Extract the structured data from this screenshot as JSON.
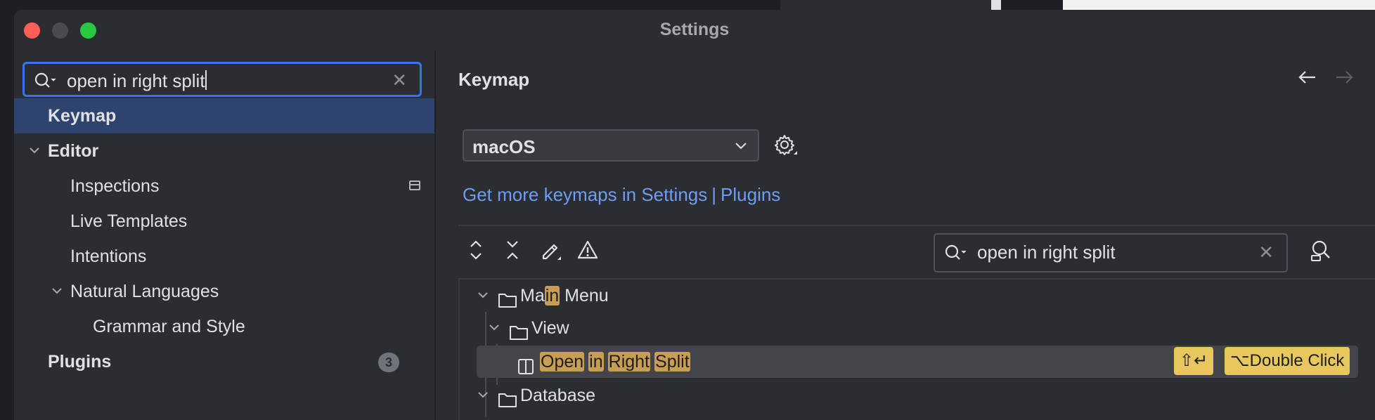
{
  "window": {
    "title": "Settings"
  },
  "sidebar": {
    "search": {
      "value": "open in right split"
    },
    "items": [
      {
        "label": "Keymap",
        "selected": true
      },
      {
        "label": "Editor",
        "expanded": true
      },
      {
        "label": "Inspections"
      },
      {
        "label": "Live Templates"
      },
      {
        "label": "Intentions"
      },
      {
        "label": "Natural Languages",
        "expanded": true
      },
      {
        "label": "Grammar and Style"
      },
      {
        "label": "Plugins",
        "badge": "3"
      }
    ]
  },
  "main": {
    "title": "Keymap",
    "keymap_select": {
      "value": "macOS"
    },
    "link_left": "Get more keymaps in Settings",
    "link_sep": "|",
    "link_right": "Plugins",
    "search": {
      "value": "open in right split"
    },
    "tree": {
      "main_menu": {
        "pre": "Ma",
        "hl": "in",
        "post": " Menu"
      },
      "view": "View",
      "action": {
        "words": [
          "Open",
          "in",
          "Right",
          "Split"
        ]
      },
      "shortcuts": [
        "⇧↵",
        "⌥Double Click"
      ],
      "database": "Database"
    }
  },
  "colors": {
    "accent": "#3574f0",
    "link": "#6f9cf5",
    "highlight": "#c89d54",
    "shortcut_bg": "#e8c85d",
    "selection": "#2e436e"
  }
}
